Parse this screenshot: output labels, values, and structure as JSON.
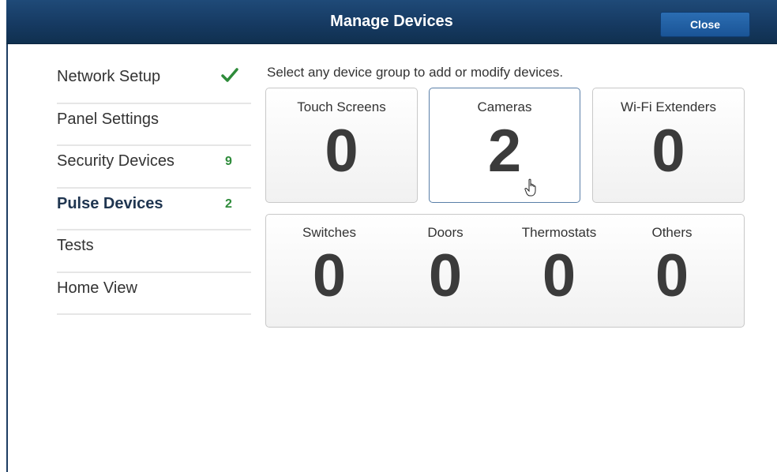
{
  "window": {
    "title": "Manage Devices",
    "close_label": "Close"
  },
  "sidebar": {
    "items": [
      {
        "label": "Network Setup",
        "status": "complete",
        "status_icon": "check-icon",
        "status_color": "#2e8b3a"
      },
      {
        "label": "Panel Settings"
      },
      {
        "label": "Security Devices",
        "badge": "9"
      },
      {
        "label": "Pulse Devices",
        "badge": "2",
        "active": true
      },
      {
        "label": "Tests"
      },
      {
        "label": "Home View"
      }
    ]
  },
  "main": {
    "instructions": "Select any device group to add or modify devices.",
    "device_groups": [
      {
        "name": "Touch Screens",
        "count": "0"
      },
      {
        "name": "Cameras",
        "count": "2",
        "selected": true
      },
      {
        "name": "Wi-Fi Extenders",
        "count": "0"
      }
    ],
    "automation_groups": [
      {
        "name": "Switches",
        "count": "0"
      },
      {
        "name": "Doors",
        "count": "0"
      },
      {
        "name": "Thermostats",
        "count": "0"
      },
      {
        "name": "Others",
        "count": "0"
      }
    ]
  },
  "colors": {
    "titlebar": "#163a62",
    "close_button": "#1a5496",
    "badge_green": "#2e8b3a",
    "selected_border": "#5a7fa8"
  },
  "icons": {
    "cursor": "hand-pointer-icon"
  }
}
